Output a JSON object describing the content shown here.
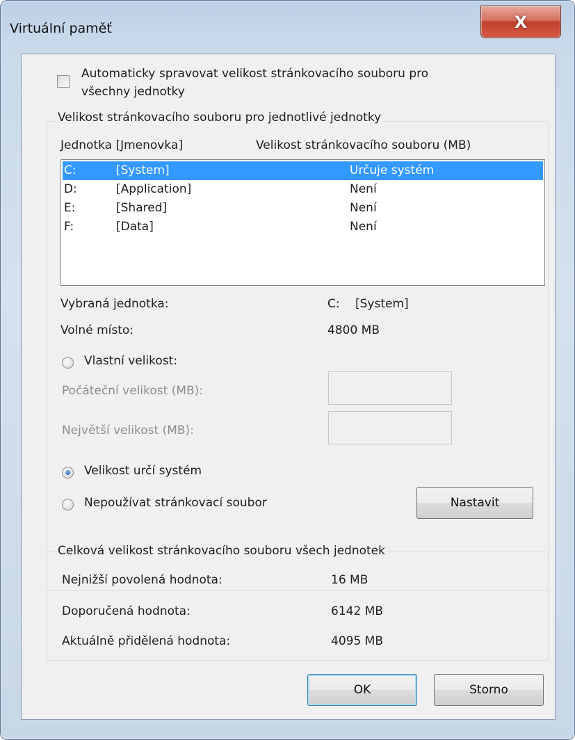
{
  "window": {
    "title": "Virtuální paměť",
    "close_glyph": "X"
  },
  "auto_manage": {
    "label_line1": "Automaticky spravovat velikost stránkovacího souboru pro",
    "label_line2": "všechny jednotky",
    "checked": false
  },
  "per_drive": {
    "legend": "Velikost stránkovacího souboru pro jednotlivé jednotky",
    "col_drive": "Jednotka [Jmenovka]",
    "col_size": "Velikost stránkovacího souboru (MB)",
    "drives": [
      {
        "letter": "C:",
        "label": "[System]",
        "size": "Určuje systém",
        "selected": true
      },
      {
        "letter": "D:",
        "label": "[Application]",
        "size": "Není",
        "selected": false
      },
      {
        "letter": "E:",
        "label": "[Shared]",
        "size": "Není",
        "selected": false
      },
      {
        "letter": "F:",
        "label": "[Data]",
        "size": "Není",
        "selected": false
      }
    ],
    "selected_drive_label": "Vybraná jednotka:",
    "selected_drive_letter": "C:",
    "selected_drive_name": "[System]",
    "free_space_label": "Volné místo:",
    "free_space_value": "4800 MB",
    "custom_size_label": "Vlastní velikost:",
    "initial_size_label": "Počáteční velikost (MB):",
    "initial_size_value": "",
    "max_size_label": "Největší velikost (MB):",
    "max_size_value": "",
    "system_managed_label": "Velikost určí systém",
    "no_paging_label": "Nepoužívat stránkovací soubor",
    "set_button": "Nastavit",
    "selected_option": "system_managed"
  },
  "totals": {
    "legend": "Celková velikost stránkovacího souboru všech jednotek",
    "min_label": "Nejnižší povolená hodnota:",
    "min_value": "16 MB",
    "recommended_label": "Doporučená hodnota:",
    "recommended_value": "6142 MB",
    "allocated_label": "Aktuálně přidělená hodnota:",
    "allocated_value": "4095 MB"
  },
  "buttons": {
    "ok": "OK",
    "cancel": "Storno"
  },
  "colors": {
    "selection": "#3399ff",
    "close_button": "#c0402c",
    "dialog_bg": "#f0f0f0"
  }
}
